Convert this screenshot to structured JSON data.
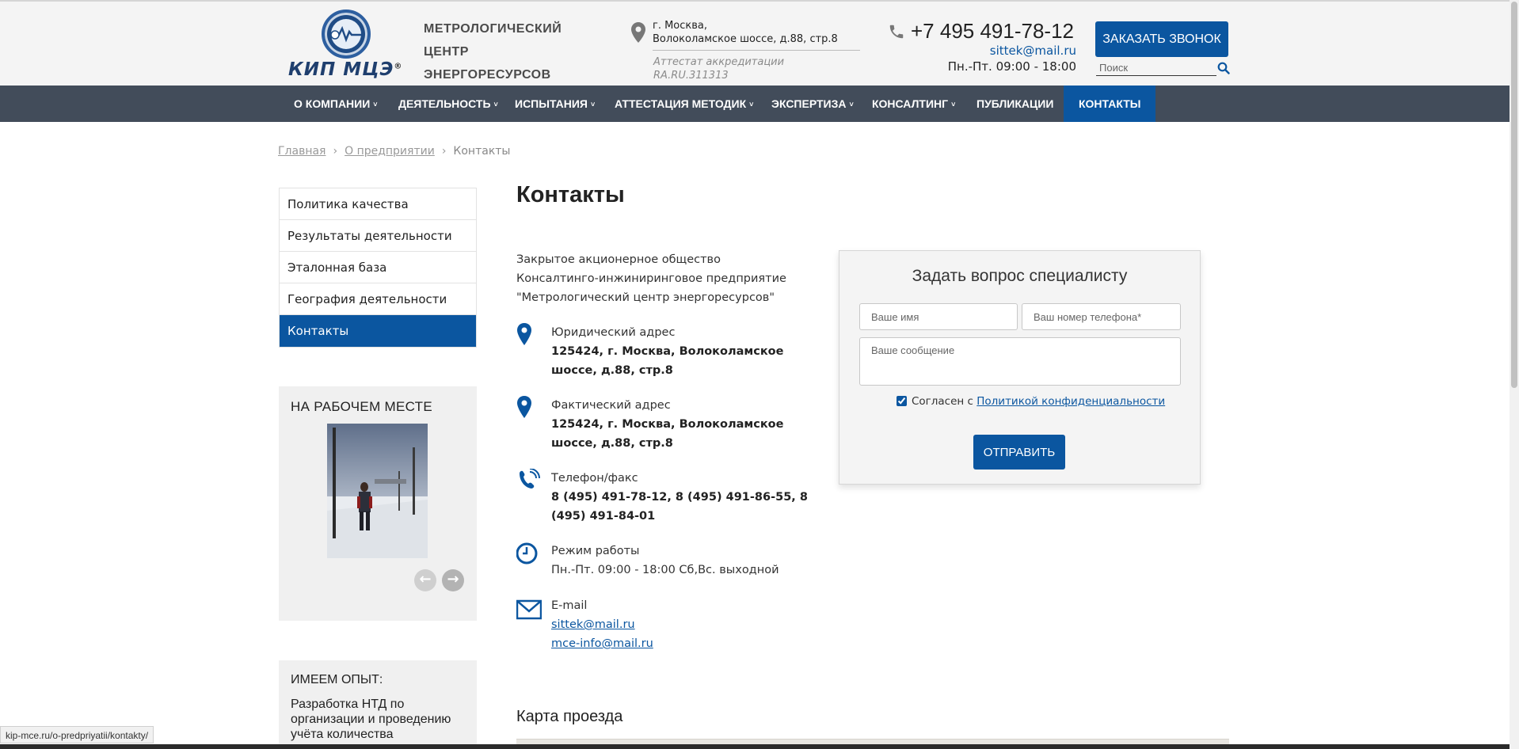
{
  "header": {
    "logo_text": "КИП МЦЭ",
    "logo_mark": "®",
    "brand_lines": [
      "МЕТРОЛОГИЧЕСКИЙ",
      "ЦЕНТР",
      "ЭНЕРГОРЕСУРСОВ"
    ],
    "address_lines": [
      "г. Москва,",
      "Волоколамское шоссе, д.88, стр.8"
    ],
    "accreditation_lines": [
      "Аттестат аккредитации",
      "RA.RU.311313"
    ],
    "phone": "+7 495 491-78-12",
    "email": "sittek@mail.ru",
    "hours": "Пн.-Пт. 09:00 - 18:00",
    "callback_label": "ЗАКАЗАТЬ ЗВОНОК",
    "search_placeholder": "Поиск",
    "icons": {
      "address": "location-pin-icon",
      "phone": "phone-icon",
      "search": "search-icon"
    }
  },
  "nav": {
    "items": [
      {
        "label": "О КОМПАНИИ",
        "has_dropdown": true
      },
      {
        "label": "ДЕЯТЕЛЬНОСТЬ",
        "has_dropdown": true
      },
      {
        "label": "ИСПЫТАНИЯ",
        "has_dropdown": true
      },
      {
        "label": "АТТЕСТАЦИЯ МЕТОДИК",
        "has_dropdown": true
      },
      {
        "label": "ЭКСПЕРТИЗА",
        "has_dropdown": true
      },
      {
        "label": "КОНСАЛТИНГ",
        "has_dropdown": true
      },
      {
        "label": "ПУБЛИКАЦИИ",
        "has_dropdown": false
      },
      {
        "label": "КОНТАКТЫ",
        "has_dropdown": false,
        "active": true
      }
    ],
    "chevron": "˅"
  },
  "breadcrumb": {
    "items": [
      "Главная",
      "О предприятии",
      "Контакты"
    ],
    "separator": "›"
  },
  "sidebar": {
    "menu": [
      {
        "label": "Политика качества"
      },
      {
        "label": "Результаты деятельности"
      },
      {
        "label": "Эталонная база"
      },
      {
        "label": "География деятельности"
      },
      {
        "label": "Контакты",
        "active": true
      }
    ],
    "work_title": "НА РАБОЧЕМ МЕСТЕ",
    "prev_glyph": "←",
    "next_glyph": "→",
    "experience_title": "ИМЕЕМ ОПЫТ:",
    "experience_text": "Разработка НТД по организации и проведению учёта количества"
  },
  "main": {
    "title": "Контакты",
    "company_lines": [
      "Закрытое акционерное общество",
      "Консалтинго-инжиниринговое предприятие",
      "\"Метрологический центр энергоресурсов\""
    ],
    "legal": {
      "label": "Юридический адрес",
      "value": "125424, г. Москва, Волоколамское шоссе, д.88, стр.8"
    },
    "actual": {
      "label": "Фактический адрес",
      "value": "125424, г. Москва, Волоколамское шоссе, д.88, стр.8"
    },
    "phones": {
      "label": "Телефон/факс",
      "value": "8 (495) 491-78-12, 8 (495) 491-86-55, 8 (495) 491-84-01"
    },
    "hours": {
      "label": "Режим работы",
      "value": "Пн.-Пт. 09:00 - 18:00 Сб,Вс. выходной"
    },
    "email": {
      "label": "E-mail",
      "links": [
        "sittek@mail.ru",
        "mce-info@mail.ru"
      ]
    },
    "map_title": "Карта проезда"
  },
  "form": {
    "title": "Задать вопрос специалисту",
    "name_placeholder": "Ваше имя",
    "phone_placeholder": "Ваш номер телефона*",
    "message_placeholder": "Ваше сообщение",
    "agree_text": "Согласен с",
    "agree_link": "Политикой конфиденциальности",
    "agree_checked": true,
    "submit_label": "ОТПРАВИТЬ"
  },
  "browser": {
    "status_url": "kip-mce.ru/o-predpriyatii/kontakty/"
  },
  "colors": {
    "accent": "#0b56a0",
    "nav_bg": "#424c5a",
    "header_bg": "#f4f4f4",
    "sidebar_block_bg": "#f0f0f0"
  }
}
